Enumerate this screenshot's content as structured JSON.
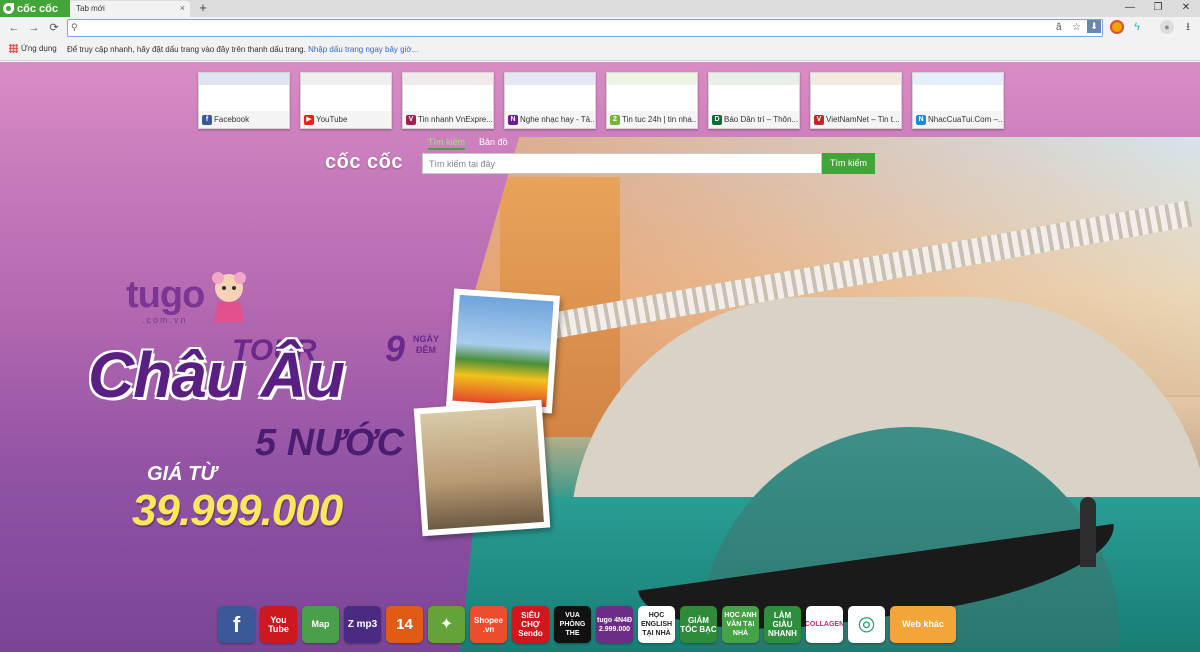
{
  "browser": {
    "brand": "cốc cốc",
    "tab_title": "Tab mới",
    "tab_close": "×",
    "new_tab": "+",
    "window_controls": [
      "—",
      "❐",
      "✕"
    ],
    "nav": {
      "back": "←",
      "forward": "→",
      "reload": "⟳"
    },
    "address": {
      "value": "",
      "translate_icon": "ă",
      "star": "☆",
      "download": "⬇"
    },
    "extensions": [
      "chrome-ext-icon",
      "feather-icon",
      "user-icon",
      "download-icon"
    ]
  },
  "bookmarks": {
    "apps_label": "Ứng dụng",
    "hint": "Để truy cập nhanh, hãy đặt dấu trang vào đây trên thanh dấu trang.",
    "import_link": "Nhập dấu trang ngay bây giờ..."
  },
  "speed_dial": [
    {
      "title": "Facebook",
      "fav": "f",
      "color": "#3b5998",
      "thumb": "#dfe3ee"
    },
    {
      "title": "YouTube",
      "fav": "▶",
      "color": "#e62117",
      "thumb": "#eeeeee"
    },
    {
      "title": "Tin nhanh VnExpre...",
      "fav": "V",
      "color": "#9f224e",
      "thumb": "#f1e9ea"
    },
    {
      "title": "Nghe nhạc hay - Tả...",
      "fav": "N",
      "color": "#6a1b9a",
      "thumb": "#e4e7f3"
    },
    {
      "title": "Tin tuc 24h | tin nha...",
      "fav": "2",
      "color": "#78b43d",
      "thumb": "#eef4e4"
    },
    {
      "title": "Báo Dân trí – Thôn...",
      "fav": "D",
      "color": "#0d6b37",
      "thumb": "#e8efe9"
    },
    {
      "title": "VietNamNet – Tin t...",
      "fav": "V",
      "color": "#c0272d",
      "thumb": "#f3ebe1"
    },
    {
      "title": "NhacCuaTui.Com –...",
      "fav": "N",
      "color": "#1e88e5",
      "thumb": "#e5eefb"
    }
  ],
  "search": {
    "logo": "cốc cốc",
    "tabs": [
      "Tìm kiếm",
      "Bản đồ"
    ],
    "placeholder": "Tìm kiếm tại đây",
    "button": "Tìm kiếm"
  },
  "ad": {
    "brand": "tugo",
    "domain": ".com.vn",
    "tour_word": "TOUR",
    "destination": "Châu Âu",
    "days_num": "9",
    "days_text": "NGÀY ĐÊM",
    "countries": "5 NƯỚC",
    "price_label": "GIÁ TỪ",
    "price": "39.999.000"
  },
  "shortcuts": [
    {
      "name": "facebook-shortcut",
      "label": "f",
      "bg": "#3b5998",
      "size": "22px"
    },
    {
      "name": "youtube-shortcut",
      "label": "You Tube",
      "bg": "#cc181e",
      "size": "9px"
    },
    {
      "name": "map-shortcut",
      "label": "Map",
      "bg": "#4a9f4a",
      "size": "9px"
    },
    {
      "name": "zing-mp3-shortcut",
      "label": "Z mp3",
      "bg": "#4b2a84",
      "size": "10px"
    },
    {
      "name": "kenh14-shortcut",
      "label": "14",
      "bg": "#e25b14",
      "size": "15px"
    },
    {
      "name": "compass-shortcut",
      "label": "✦",
      "bg": "#64a23a",
      "size": "16px"
    },
    {
      "name": "shopee-shortcut",
      "label": "Shopee .vn",
      "bg": "#ee4d2d",
      "size": "8px"
    },
    {
      "name": "sendo-shortcut",
      "label": "SIÊU CHỢ Sendo",
      "bg": "#d3161c",
      "size": "8px"
    },
    {
      "name": "vua-phong-the-shortcut",
      "label": "VUA PHÒNG THE",
      "bg": "#111111",
      "size": "7px"
    },
    {
      "name": "tugo-shortcut",
      "label": "tugo 4N4Đ 2.999.000",
      "bg": "#6b2d86",
      "size": "7px"
    },
    {
      "name": "hoc-english-shortcut",
      "label": "HỌC ENGLISH TẠI NHÀ",
      "bg": "#ffffff",
      "fg": "#222222",
      "size": "7px"
    },
    {
      "name": "giam-toc-bac-shortcut",
      "label": "GIẢM TÓC BẠC",
      "bg": "#2e8b3a",
      "size": "8px"
    },
    {
      "name": "hoc-anh-van-shortcut",
      "label": "HỌC ANH VĂN TẠI NHÀ",
      "bg": "#45a346",
      "size": "7px"
    },
    {
      "name": "lam-giau-shortcut",
      "label": "LÀM GIÀU NHANH",
      "bg": "#2d8f3c",
      "size": "8px"
    },
    {
      "name": "collagen-shortcut",
      "label": "COLLAGEN",
      "bg": "#ffffff",
      "fg": "#d22a6a",
      "size": "7px"
    },
    {
      "name": "green-circle-shortcut",
      "label": "◎",
      "bg": "#ffffff",
      "fg": "#1f9c6a",
      "size": "20px"
    },
    {
      "name": "web-khac-shortcut",
      "label": "Web khác",
      "bg": "#f3a53a",
      "size": "9px",
      "wide": true
    }
  ]
}
